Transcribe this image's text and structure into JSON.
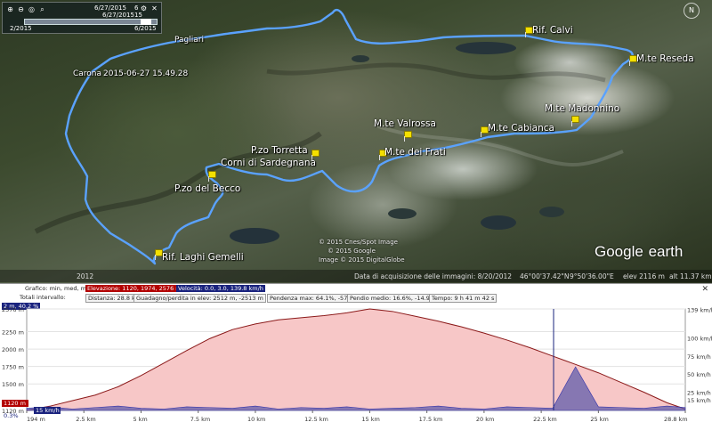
{
  "map": {
    "timeslider": {
      "start_date": "2/2015",
      "end_date": "6/2015",
      "current_date_1": "6/27/2015",
      "current_date_2": "6/27/2015",
      "n1": "6",
      "n2": "15"
    },
    "nav_label": "N",
    "placemarks": [
      {
        "id": "rif-calvi",
        "label": "Rif. Calvi"
      },
      {
        "id": "mte-reseda",
        "label": "M.te Reseda"
      },
      {
        "id": "mte-madonnino",
        "label": "M.te Madonnino"
      },
      {
        "id": "mte-valrossa",
        "label": "M.te Valrossa"
      },
      {
        "id": "mte-cabianca",
        "label": "M.te Cabianca"
      },
      {
        "id": "mte-dei-frati",
        "label": "M.te dei Frati"
      },
      {
        "id": "pzo-torretta",
        "label": "P.zo Torretta"
      },
      {
        "id": "corni-di-sardegnana",
        "label": "Corni di Sardegnana"
      },
      {
        "id": "pzo-del-becco",
        "label": "P.zo del Becco"
      },
      {
        "id": "rif-laghi-gemelli",
        "label": "Rif. Laghi Gemelli"
      }
    ],
    "town_labels": {
      "pagliari": "Pagliari",
      "carona": "Carona",
      "timestamp": "2015-06-27 15.49.28"
    },
    "logo": {
      "main": "Google",
      "suffix": "earth"
    },
    "copyright_lines": [
      "© 2015 Cnes/Spot Image",
      "© 2015 Google",
      "Image © 2015 DigitalGlobe"
    ],
    "status": {
      "year": "2012",
      "acquisition": "Data di acquisizione delle immagini: 8/20/2012",
      "lat": "46°00'37.42\"N",
      "lon": "9°50'36.00\"E",
      "elev": "elev  2116 m",
      "alt": "alt  11.37 km"
    }
  },
  "profile": {
    "row1": {
      "chart_label": "Grafico:  min, med, max",
      "elevation": "Elevazione: 1120, 1974, 2576 m",
      "speed": "Velocità: 0.0, 3.0, 139.8 km/h"
    },
    "row2": {
      "totals": "Totali intervallo:",
      "distance": "Distanza: 28.8 km",
      "gain": "Guadagno/perdita in elev: 2512 m, -2513 m",
      "slope_max": "Pendenza max: 64.1%, -57.3%",
      "slope_avg": "Pendio medio: 16.6%, -14.9%",
      "time": "Tempo: 9 h 41 m 42 s"
    },
    "cursor_value": "2 m, 40.2 %",
    "close_label": "✕",
    "y_left": [
      "2576 m",
      "2250 m",
      "2000 m",
      "1750 m",
      "1500 m",
      "1120 m"
    ],
    "y_right": [
      "139 km/h",
      "100 km/h",
      "75 km/h",
      "50 km/h",
      "25 km/h",
      "15 km/h"
    ],
    "x_ticks": [
      "194 m",
      "2.5 km",
      "5 km",
      "7.5 km",
      "10 km",
      "12.5 km",
      "15 km",
      "17.5 km",
      "20 km",
      "22.5 km",
      "25 km",
      "28.8 km"
    ],
    "min_tags": {
      "elev": "1120 m",
      "speed": "15 km/h",
      "pct": "0.3%"
    },
    "colors": {
      "elevation_fill": "#f7c7c7",
      "elevation_line": "#8b1a1a",
      "speed_fill": "#5555aa",
      "cursor": "#1a237e"
    }
  },
  "chart_data": {
    "type": "area",
    "xlabel": "",
    "ylabel": "",
    "x": [
      0,
      1,
      2,
      3,
      4,
      5,
      6,
      7,
      8,
      9,
      10,
      11,
      12,
      13,
      14,
      15,
      16,
      17,
      18,
      19,
      20,
      21,
      22,
      23,
      24,
      25,
      26,
      27,
      28,
      28.8
    ],
    "series": [
      {
        "values": [
          1120,
          1180,
          1260,
          1340,
          1460,
          1620,
          1800,
          1980,
          2150,
          2280,
          2360,
          2420,
          2450,
          2480,
          2520,
          2576,
          2540,
          2470,
          2400,
          2320,
          2230,
          2130,
          2020,
          1900,
          1780,
          1660,
          1520,
          1380,
          1230,
          1140
        ]
      },
      {
        "values": [
          3,
          5,
          2,
          4,
          6,
          3,
          2,
          5,
          4,
          3,
          6,
          2,
          4,
          3,
          5,
          2,
          3,
          4,
          6,
          3,
          2,
          5,
          4,
          3,
          60,
          5,
          4,
          3,
          6,
          4
        ]
      }
    ],
    "ylim": [
      1120,
      2576
    ],
    "xlim": [
      0,
      28.8
    ]
  }
}
